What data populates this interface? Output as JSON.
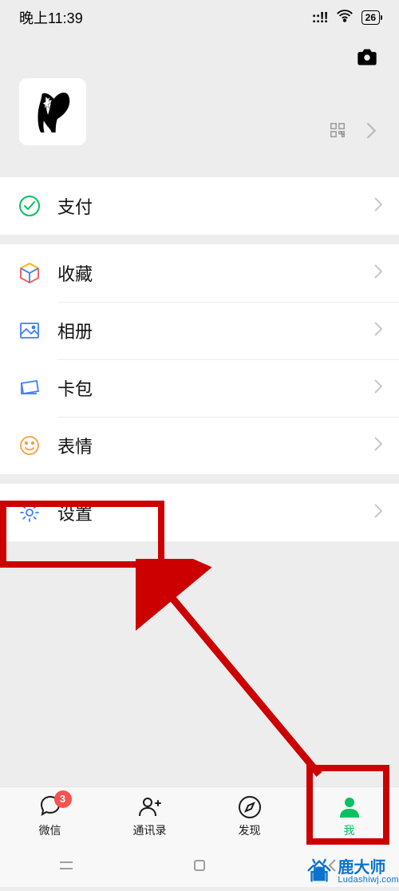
{
  "status": {
    "time": "晚上11:39",
    "signal": "::!!",
    "battery": "26"
  },
  "menu": {
    "pay": {
      "label": "支付"
    },
    "favorites": {
      "label": "收藏"
    },
    "album": {
      "label": "相册"
    },
    "cards": {
      "label": "卡包"
    },
    "stickers": {
      "label": "表情"
    },
    "settings": {
      "label": "设置"
    }
  },
  "tabs": {
    "chats": {
      "label": "微信",
      "badge": "3"
    },
    "contacts": {
      "label": "通讯录"
    },
    "discover": {
      "label": "发现"
    },
    "me": {
      "label": "我"
    }
  },
  "watermark": {
    "cn": "鹿大师",
    "en": "Ludashiwj.com"
  }
}
